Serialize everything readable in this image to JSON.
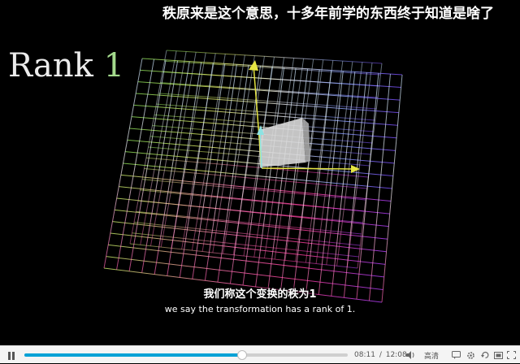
{
  "video": {
    "danmaku": "秩原来是这个意思，十多年前学的东西终于知道是啥了",
    "rank_label": {
      "word": "Rank",
      "value": "1"
    },
    "subtitle": {
      "cn": "我们称这个变换的秩为1",
      "en": "we say the transformation has a rank of 1."
    }
  },
  "controls": {
    "current_time": "08:11",
    "separator": "/",
    "duration": "12:08",
    "progress": 0.674,
    "quality_label": "高清",
    "icons": [
      "pause-icon",
      "volume-icon",
      "danmaku-icon",
      "settings-icon",
      "loop-icon",
      "wide-screen-icon",
      "fullscreen-icon"
    ]
  },
  "colors": {
    "accent": "#00a1d6",
    "rank_number": "#a3d98c"
  }
}
